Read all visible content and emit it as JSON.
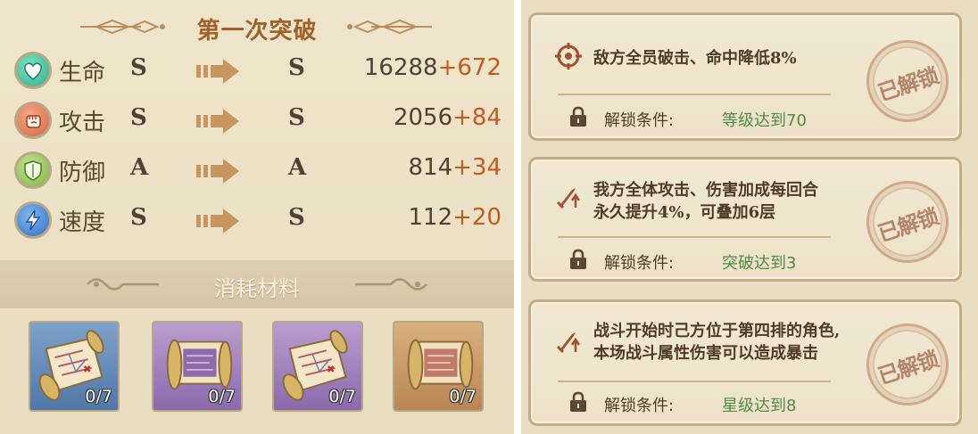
{
  "breakthrough": {
    "title": "第一次突破",
    "stats": [
      {
        "icon": "heart-icon",
        "label": "生命",
        "from": "S",
        "to": "S",
        "value": "16288",
        "bonus": "+672",
        "color": "#3fbf9a"
      },
      {
        "icon": "fist-icon",
        "label": "攻击",
        "from": "S",
        "to": "S",
        "value": "2056",
        "bonus": "+84",
        "color": "#e07a56"
      },
      {
        "icon": "shield-icon",
        "label": "防御",
        "from": "A",
        "to": "A",
        "value": "814",
        "bonus": "+34",
        "color": "#8fc25a"
      },
      {
        "icon": "lightning-icon",
        "label": "速度",
        "from": "S",
        "to": "S",
        "value": "112",
        "bonus": "+20",
        "color": "#3e86d6"
      }
    ]
  },
  "materials": {
    "label": "消耗材料",
    "items": [
      {
        "icon": "scroll-map-icon",
        "count": "0/7",
        "rarity": "blue"
      },
      {
        "icon": "scroll-purple-icon",
        "count": "0/7",
        "rarity": "purple"
      },
      {
        "icon": "scroll-map-icon",
        "count": "0/7",
        "rarity": "purple"
      },
      {
        "icon": "scroll-orange-icon",
        "count": "0/7",
        "rarity": "orange"
      }
    ]
  },
  "skills": [
    {
      "icon": "crosshair-icon",
      "desc_lines": [
        "敌方全员破击、命中降低8%"
      ],
      "condition_label": "解锁条件:",
      "condition_value": "等级达到70",
      "stamp": "已解锁"
    },
    {
      "icon": "sword-up-icon",
      "desc_lines": [
        "我方全体攻击、伤害加成每回合",
        "永久提升4%，可叠加6层"
      ],
      "condition_label": "解锁条件:",
      "condition_value": "突破达到3",
      "stamp": "已解锁"
    },
    {
      "icon": "sword-up-icon",
      "desc_lines": [
        "战斗开始时己方位于第四排的角色,",
        "本场战斗属性伤害可以造成暴击"
      ],
      "condition_label": "解锁条件:",
      "condition_value": "星级达到8",
      "stamp": "已解锁"
    }
  ]
}
